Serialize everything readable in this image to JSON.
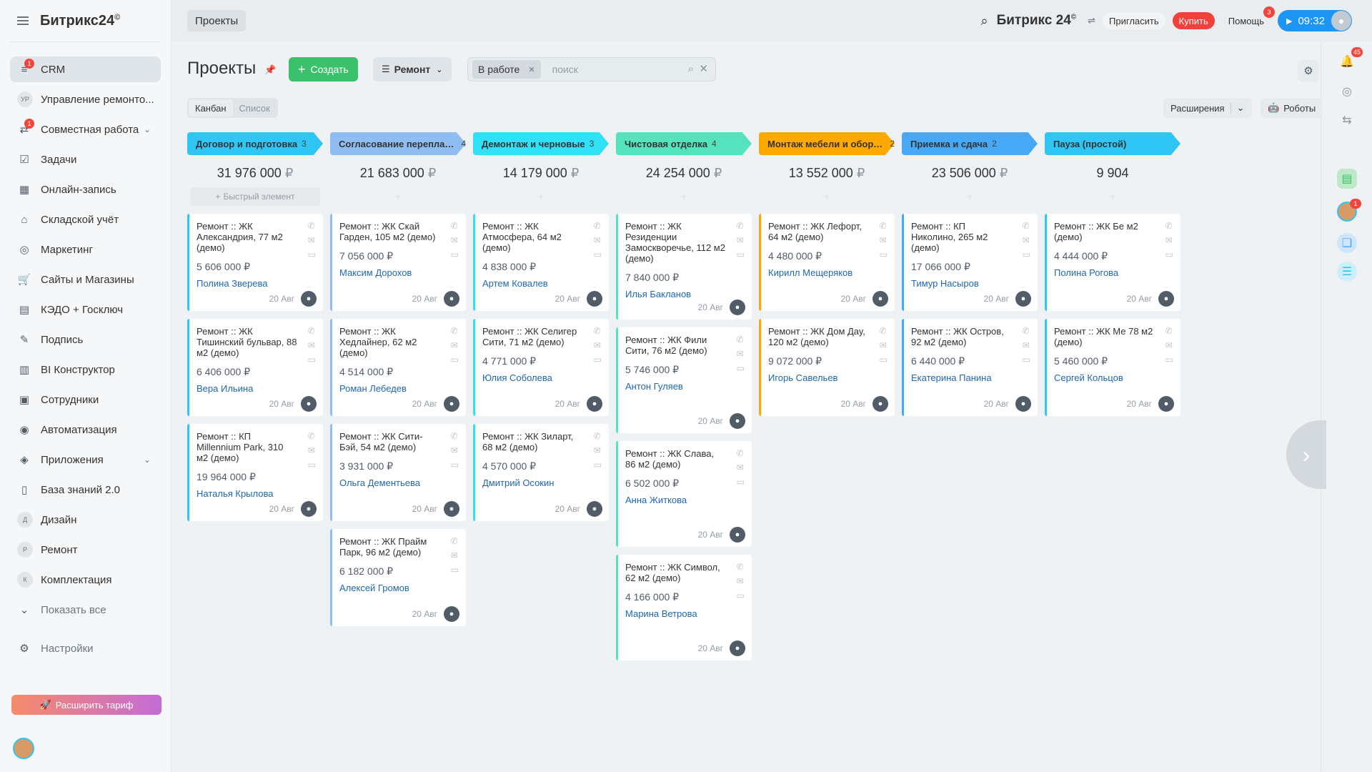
{
  "logo": {
    "name": "Битрикс",
    "num": "24",
    "mark": "©"
  },
  "sidebar": {
    "items": [
      {
        "label": "CRM",
        "icon": "crm-funnel-icon",
        "badge": "1"
      },
      {
        "label": "Управление ремонто...",
        "letters": "УР"
      },
      {
        "label": "Совместная работа",
        "icon": "collab-icon",
        "badge": "1",
        "chevron": true
      },
      {
        "label": "Задачи",
        "icon": "task-check-icon"
      },
      {
        "label": "Онлайн-запись",
        "icon": "calendar-icon"
      },
      {
        "label": "Складской учёт",
        "icon": "warehouse-icon"
      },
      {
        "label": "Маркетинг",
        "icon": "marketing-icon"
      },
      {
        "label": "Сайты и Магазины",
        "icon": "cart-icon"
      },
      {
        "label": "КЭДО + Госключ",
        "icon": "document-icon"
      },
      {
        "label": "Подпись",
        "icon": "signature-icon"
      },
      {
        "label": "BI Конструктор",
        "icon": "bar-chart-icon"
      },
      {
        "label": "Сотрудники",
        "icon": "employees-icon"
      },
      {
        "label": "Автоматизация",
        "icon": "automation-icon"
      },
      {
        "label": "Приложения",
        "icon": "apps-cube-icon",
        "chevron": true
      },
      {
        "label": "База знаний 2.0",
        "icon": "books-icon"
      },
      {
        "label": "Дизайн",
        "letters": "Д"
      },
      {
        "label": "Ремонт",
        "letters": "Р"
      },
      {
        "label": "Комплектация",
        "letters": "К"
      },
      {
        "label": "Показать все",
        "icon": "chevron-down-icon"
      }
    ],
    "settings_label": "Настройки",
    "upgrade_label": "Расширить тариф"
  },
  "topbar": {
    "tab_label": "Проекты",
    "brand": "Битрикс 24",
    "invite_label": "Пригласить",
    "buy_label": "Купить",
    "help_label": "Помощь",
    "help_badge": "3",
    "time": "09:32"
  },
  "rail": {
    "bell_badge": "45",
    "avatar_badge": "1"
  },
  "page": {
    "title": "Проекты",
    "create_label": "Создать",
    "category_label": "Ремонт",
    "filter_chip": "В работе",
    "search_placeholder": "поиск",
    "view_kanban": "Канбан",
    "view_list": "Список",
    "extensions_label": "Расширения",
    "robots_label": "Роботы",
    "quick_add_label": "Быстрый элемент",
    "card_date": "20 Авг"
  },
  "colors": {
    "accent": "#2fc6f6",
    "create_green": "#3bc06b",
    "buy_red": "#f0413c"
  },
  "columns": [
    {
      "title": "Договор и подготовка",
      "count": "3",
      "sum": "31 976 000",
      "currency": "₽",
      "color": "#2fc6f6",
      "stripe": "#2fc6f6",
      "cards": [
        {
          "title": "Ремонт :: ЖК Александрия, 77 м2 (демо)",
          "sum": "5 606 000 ₽",
          "person": "Полина Зверева"
        },
        {
          "title": "Ремонт :: ЖК Тишинский бульвар, 88 м2 (демо)",
          "sum": "6 406 000 ₽",
          "person": "Вера Ильина"
        },
        {
          "title": "Ремонт :: КП Millennium Park, 310 м2 (демо)",
          "sum": "19 964 000 ₽",
          "person": "Наталья Крылова"
        }
      ]
    },
    {
      "title": "Согласование перепланир...",
      "count": "4",
      "sum": "21 683 000",
      "currency": "₽",
      "color": "#8fbdf2",
      "stripe": "#8fbdf2",
      "cards": [
        {
          "title": "Ремонт :: ЖК Скай Гарден, 105 м2 (демо)",
          "sum": "7 056 000 ₽",
          "person": "Максим Дорохов"
        },
        {
          "title": "Ремонт :: ЖК Хедлайнер, 62 м2 (демо)",
          "sum": "4 514 000 ₽",
          "person": "Роман Лебедев"
        },
        {
          "title": "Ремонт :: ЖК Сити-Бэй, 54 м2 (демо)",
          "sum": "3 931 000 ₽",
          "person": "Ольга Дементьева"
        },
        {
          "title": "Ремонт :: ЖК Прайм Парк, 96 м2 (демо)",
          "sum": "6 182 000 ₽",
          "person": "Алексей Громов"
        }
      ]
    },
    {
      "title": "Демонтаж и черновые",
      "count": "3",
      "sum": "14 179 000",
      "currency": "₽",
      "color": "#2fe0f6",
      "stripe": "#2fe0f6",
      "cards": [
        {
          "title": "Ремонт :: ЖК Атмосфера, 64 м2 (демо)",
          "sum": "4 838 000 ₽",
          "person": "Артем Ковалев"
        },
        {
          "title": "Ремонт :: ЖК Селигер Сити, 71 м2 (демо)",
          "sum": "4 771 000 ₽",
          "person": "Юлия Соболева"
        },
        {
          "title": "Ремонт :: ЖК Зиларт, 68 м2 (демо)",
          "sum": "4 570 000 ₽",
          "person": "Дмитрий Осокин"
        }
      ]
    },
    {
      "title": "Чистовая отделка",
      "count": "4",
      "sum": "24 254 000",
      "currency": "₽",
      "color": "#55e3be",
      "stripe": "#55e3be",
      "cards": [
        {
          "title": "Ремонт :: ЖК Резиденции Замоскворечье, 112 м2 (демо)",
          "sum": "7 840 000 ₽",
          "person": "Илья Бакланов",
          "tall": true
        },
        {
          "title": "Ремонт :: ЖК Фили Сити, 76 м2 (демо)",
          "sum": "5 746 000 ₽",
          "person": "Антон Гуляев",
          "tall": true
        },
        {
          "title": "Ремонт :: ЖК Слава, 86 м2 (демо)",
          "sum": "6 502 000 ₽",
          "person": "Анна Житкова",
          "tall": true
        },
        {
          "title": "Ремонт :: ЖК Символ, 62 м2 (демо)",
          "sum": "4 166 000 ₽",
          "person": "Марина Ветрова",
          "tall": true
        }
      ]
    },
    {
      "title": "Монтаж мебели и оборудо...",
      "count": "2",
      "sum": "13 552 000",
      "currency": "₽",
      "color": "#ffa900",
      "stripe": "#ffa900",
      "cards": [
        {
          "title": "Ремонт :: ЖК Лефорт, 64 м2 (демо)",
          "sum": "4 480 000 ₽",
          "person": "Кирилл Мещеряков"
        },
        {
          "title": "Ремонт :: ЖК Дом Дау, 120 м2 (демо)",
          "sum": "9 072 000 ₽",
          "person": "Игорь Савельев"
        }
      ]
    },
    {
      "title": "Приемка и сдача",
      "count": "2",
      "sum": "23 506 000",
      "currency": "₽",
      "color": "#47a8f5",
      "stripe": "#47a8f5",
      "cards": [
        {
          "title": "Ремонт :: КП Николино, 265 м2 (демо)",
          "sum": "17 066 000 ₽",
          "person": "Тимур Насыров"
        },
        {
          "title": "Ремонт :: ЖК Остров, 92 м2 (демо)",
          "sum": "6 440 000 ₽",
          "person": "Екатерина Панина"
        }
      ]
    },
    {
      "title": "Пауза (простой)",
      "count": "",
      "sum": "9 904",
      "currency": "",
      "color": "#2fc6f6",
      "stripe": "#2fc6f6",
      "cards": [
        {
          "title": "Ремонт :: ЖК Бе м2 (демо)",
          "sum": "4 444 000 ₽",
          "person": "Полина Рогова"
        },
        {
          "title": "Ремонт :: ЖК Ме 78 м2 (демо)",
          "sum": "5 460 000 ₽",
          "person": "Сергей Кольцов"
        }
      ]
    }
  ]
}
